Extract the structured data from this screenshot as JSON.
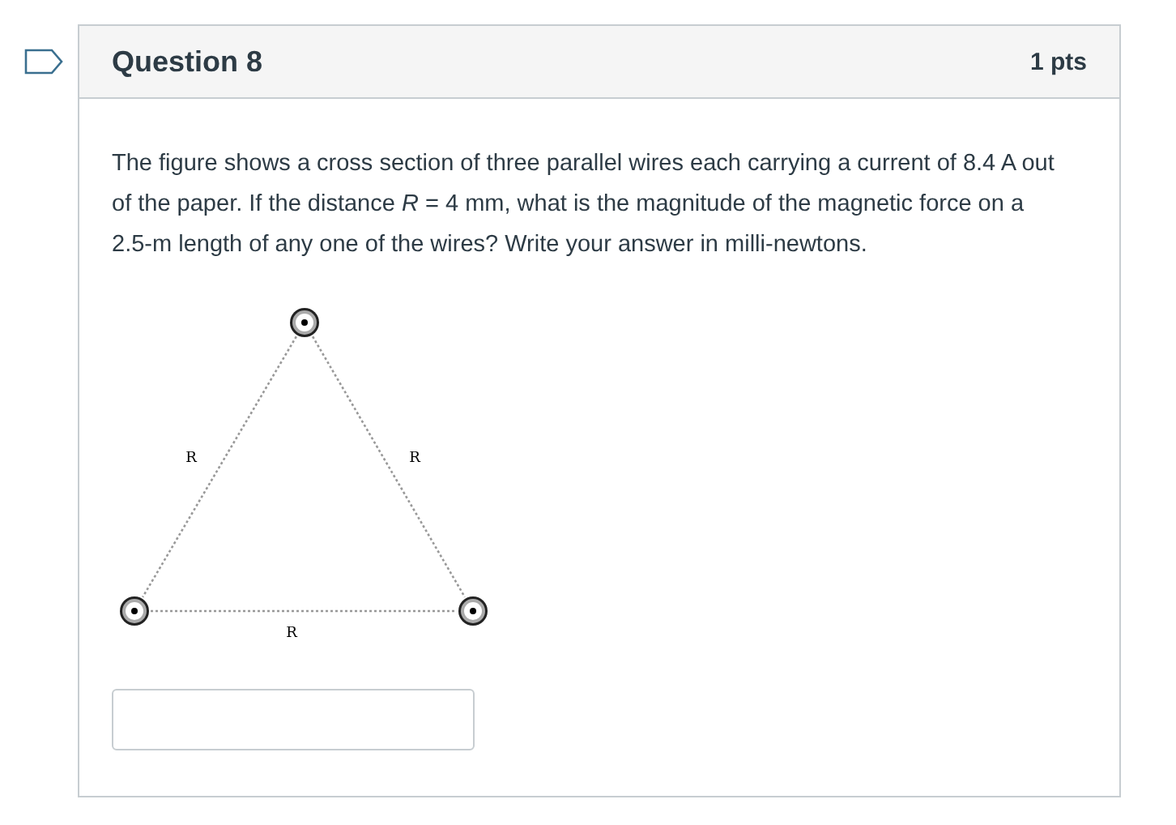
{
  "question": {
    "title": "Question 8",
    "points": "1 pts",
    "flagged": false,
    "text": "The figure shows a cross section of three parallel wires each carrying a current of 8.4 A out of the paper. If the distance *R* = 4 mm, what is the magnitude of the magnetic force on a 2.5-m length of any one of the wires? Write your answer in milli-newtons.",
    "figure": {
      "labels": [
        "R",
        "R",
        "R"
      ]
    }
  }
}
